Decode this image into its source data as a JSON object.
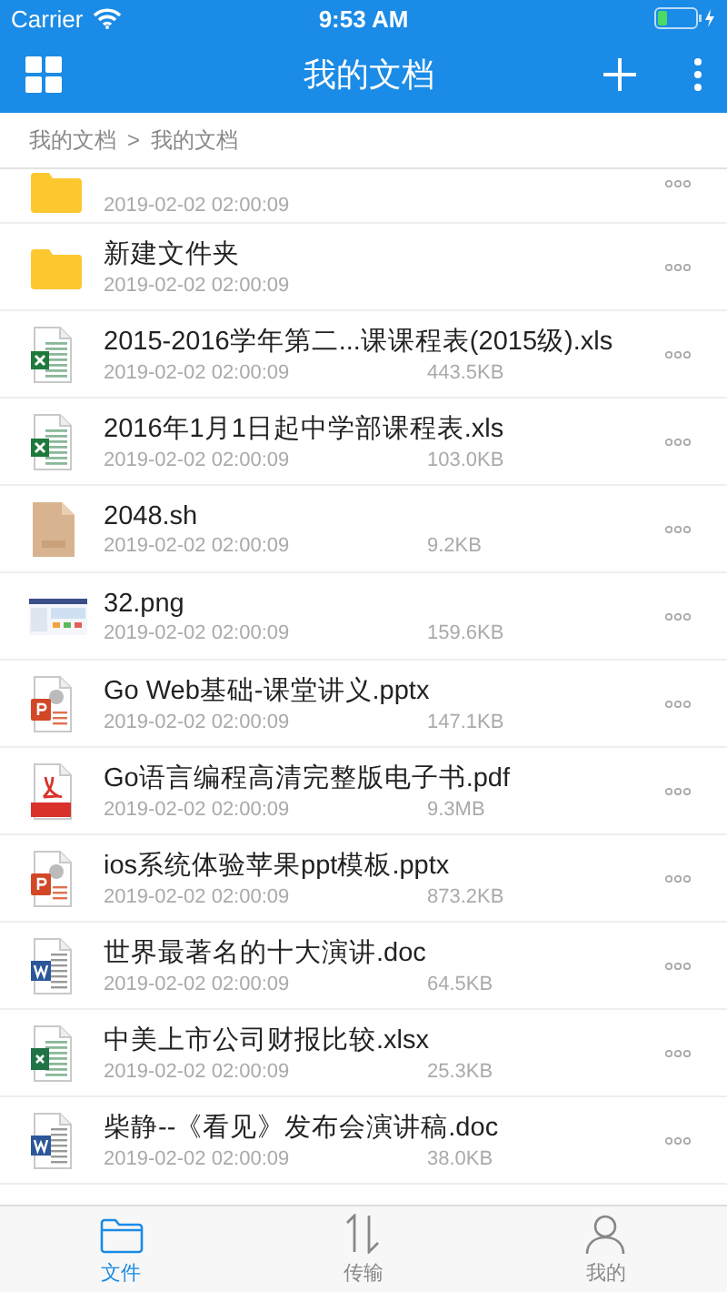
{
  "status_bar": {
    "carrier": "Carrier",
    "time": "9:53 AM"
  },
  "nav_bar": {
    "title": "我的文档"
  },
  "breadcrumb": [
    {
      "label": "我的文档"
    },
    {
      "label": ">"
    },
    {
      "label": "我的文档"
    }
  ],
  "files": [
    {
      "kind": "folder",
      "date": "2019-02-02 02:00:09",
      "partly_hidden": true
    },
    {
      "kind": "folder",
      "name": "新建文件夹",
      "date": "2019-02-02 02:00:09"
    },
    {
      "kind": "excel",
      "name": "2015-2016学年第二...课课程表(2015级).xls",
      "date": "2019-02-02 02:00:09",
      "size": "443.5KB"
    },
    {
      "kind": "excel",
      "name": "2016年1月1日起中学部课程表.xls",
      "date": "2019-02-02 02:00:09",
      "size": "103.0KB"
    },
    {
      "kind": "script",
      "name": "2048.sh",
      "date": "2019-02-02 02:00:09",
      "size": "9.2KB"
    },
    {
      "name": "32.png",
      "date": "2019-02-02 02:00:09",
      "size": "159.6KB"
    },
    {
      "kind": "powerpoint",
      "name": "Go Web基础-课堂讲义.pptx",
      "date": "2019-02-02 02:00:09",
      "size": "147.1KB"
    },
    {
      "kind": "pdf",
      "name": "Go语言编程高清完整版电子书.pdf",
      "date": "2019-02-02 02:00:09",
      "size": "9.3MB"
    },
    {
      "kind": "powerpoint",
      "name": "ios系统体验苹果ppt模板.pptx",
      "date": "2019-02-02 02:00:09",
      "size": "873.2KB"
    },
    {
      "kind": "word",
      "name": "世界最著名的十大演讲.doc",
      "date": "2019-02-02 02:00:09",
      "size": "64.5KB"
    },
    {
      "kind": "xlsx",
      "name": "中美上市公司财报比较.xlsx",
      "date": "2019-02-02 02:00:09",
      "size": "25.3KB"
    },
    {
      "kind": "word",
      "name": "柴静--《看见》发布会演讲稿.doc",
      "date": "2019-02-02 02:00:09",
      "size": "38.0KB"
    }
  ],
  "tabs": [
    {
      "kind": "files",
      "label": "文件",
      "selected": true
    },
    {
      "kind": "transfer",
      "label": "传输",
      "selected": false
    },
    {
      "kind": "profile",
      "label": "我的",
      "selected": false
    }
  ]
}
